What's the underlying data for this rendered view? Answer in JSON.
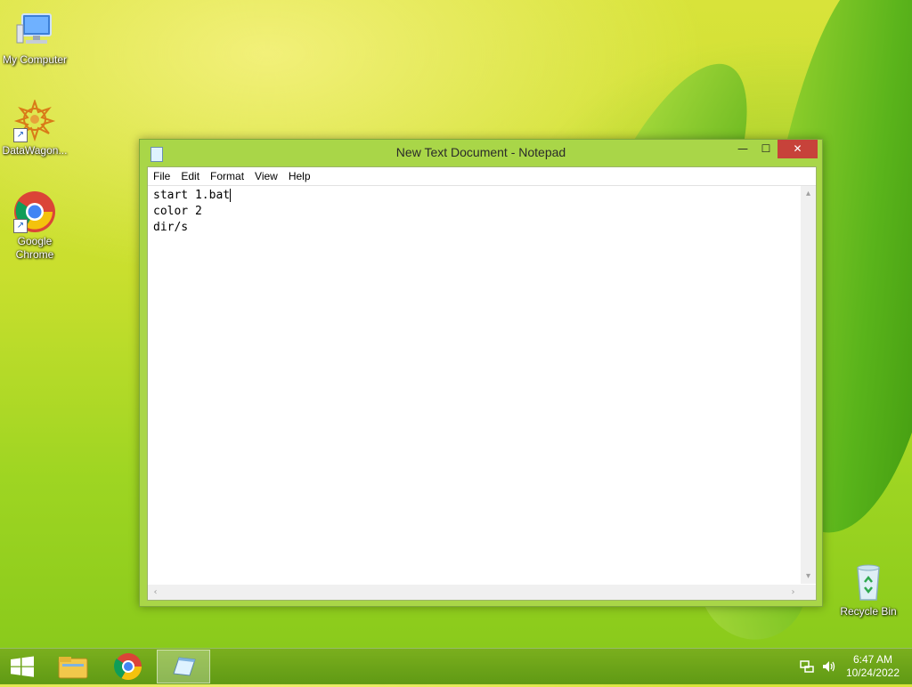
{
  "desktop": {
    "icons": [
      {
        "label": "My Computer",
        "icon": "computer-icon"
      },
      {
        "label": "DataWagon...",
        "icon": "datawagon-icon"
      },
      {
        "label": "Google Chrome",
        "icon": "chrome-icon"
      },
      {
        "label": "Recycle Bin",
        "icon": "recycle-bin-icon"
      }
    ]
  },
  "notepad": {
    "title": "New Text Document - Notepad",
    "menu": [
      "File",
      "Edit",
      "Format",
      "View",
      "Help"
    ],
    "content": [
      "start 1.bat",
      "color 2",
      "dir/s"
    ],
    "minimize_glyph": "—",
    "maximize_glyph": "☐",
    "close_glyph": "✕"
  },
  "taskbar": {
    "items": [
      "start-button",
      "file-explorer-icon",
      "chrome-icon",
      "notepad-icon"
    ],
    "active_item": "notepad-icon",
    "clock_time": "6:47 AM",
    "clock_date": "10/24/2022"
  },
  "colors": {
    "accent": "#a9d648",
    "close_button": "#c7423a"
  }
}
